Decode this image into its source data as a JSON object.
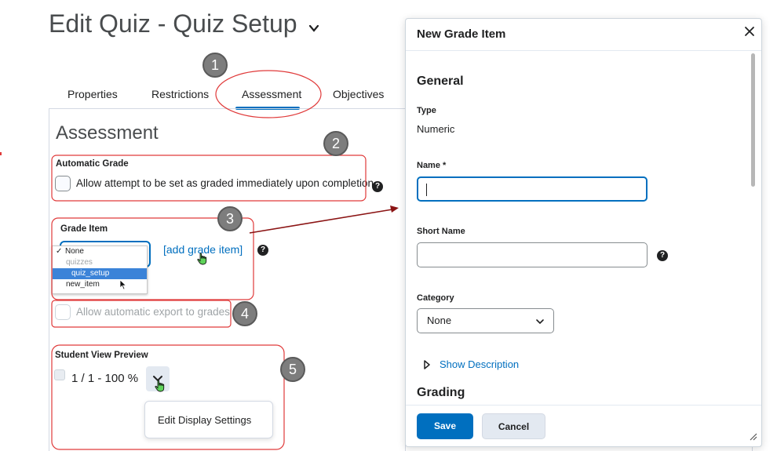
{
  "page": {
    "title": "Edit Quiz - Quiz Setup",
    "tabs": [
      {
        "label": "Properties"
      },
      {
        "label": "Restrictions"
      },
      {
        "label": "Assessment"
      },
      {
        "label": "Objectives"
      }
    ],
    "active_tab": "Assessment"
  },
  "assessment": {
    "heading": "Assessment",
    "automatic_grade": {
      "label": "Automatic Grade",
      "checkbox_text": "Allow attempt to be set as graded immediately upon completion",
      "checked": false
    },
    "grade_item": {
      "label": "Grade Item",
      "options": [
        {
          "label": "None",
          "selected_marker": "✓"
        },
        {
          "label": "quizzes",
          "group": true
        },
        {
          "label": "quiz_setup",
          "highlighted": true
        },
        {
          "label": "new_item"
        }
      ],
      "add_link": "[add grade item]"
    },
    "export": {
      "checkbox_text": "Allow automatic export to grades",
      "enabled": false
    },
    "student_view": {
      "label": "Student View Preview",
      "score_text": "1 / 1 - 100 %",
      "menu_item": "Edit Display Settings"
    }
  },
  "callouts": [
    "1",
    "2",
    "3",
    "4",
    "5"
  ],
  "dialog": {
    "title": "New Grade Item",
    "general_heading": "General",
    "type_label": "Type",
    "type_value": "Numeric",
    "name_label": "Name *",
    "name_value": "",
    "short_name_label": "Short Name",
    "short_name_value": "",
    "category_label": "Category",
    "category_value": "None",
    "show_description": "Show Description",
    "grading_heading": "Grading",
    "save_label": "Save",
    "cancel_label": "Cancel"
  },
  "colors": {
    "accent": "#006fbf",
    "annotation_red": "#e03a3a",
    "arrow": "#8b1414",
    "callout_gray": "#7d7d7d"
  },
  "icons": [
    "chevron-down-icon",
    "help-icon",
    "close-icon",
    "triangle-right-icon",
    "pointer-hand-icon",
    "cursor-arrow-icon",
    "resize-grip-icon"
  ]
}
